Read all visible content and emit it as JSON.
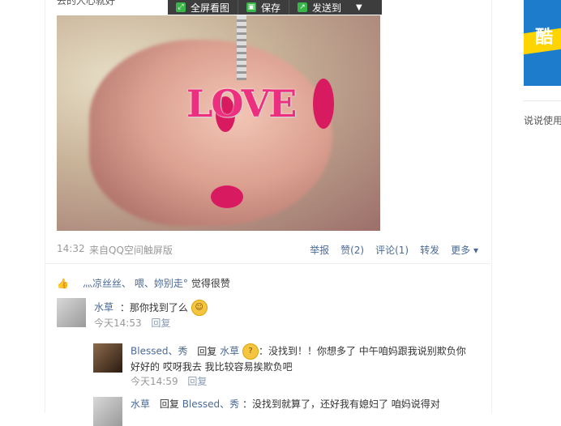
{
  "top_text": "去的人心就好",
  "toolbar": {
    "fullscreen": "全屏看图",
    "save": "保存",
    "send": "发送到"
  },
  "photo": {
    "caption_word": "LOVE"
  },
  "meta": {
    "time": "14:32",
    "source": "来自QQ空间触屏版",
    "report": "举报",
    "like": "赞(2)",
    "comment": "评论(1)",
    "forward": "转发",
    "more": "更多"
  },
  "likes": {
    "users": "灬凉丝丝、 喂、妳别走°",
    "suffix": "觉得很赞"
  },
  "comments": [
    {
      "name": "水草",
      "text": "：那你找到了么",
      "time": "今天14:53",
      "reply": "回复"
    },
    {
      "name": "Blessed、秀",
      "reply_word": "回复",
      "target": "水草",
      "text": "：没找到！！你想多了 中午咱妈跟我说别欺负你好好的 哎呀我去 我比较容易挨欺负吧",
      "time": "今天14:59",
      "reply": "回复"
    },
    {
      "name": "水草",
      "reply_word": "回复",
      "target": "Blessed、秀",
      "text": "：没找到就算了，还好我有媳妇了 咱妈说得对"
    }
  ],
  "right": {
    "ad_text": "酷",
    "link": "说说使用"
  }
}
